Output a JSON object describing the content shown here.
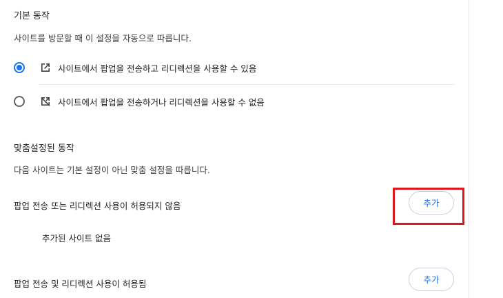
{
  "default_behavior": {
    "title": "기본 동작",
    "description": "사이트를 방문할 때 이 설정을 자동으로 따릅니다.",
    "options": [
      {
        "label": "사이트에서 팝업을 전송하고 리디렉션을 사용할 수 있음",
        "selected": true,
        "icon": "open-in-new-icon"
      },
      {
        "label": "사이트에서 팝업을 전송하거나 리디렉션을 사용할 수 없음",
        "selected": false,
        "icon": "open-in-new-off-icon"
      }
    ]
  },
  "custom_behavior": {
    "title": "맞춤설정된 동작",
    "description": "다음 사이트는 기본 설정이 아닌 맞춤 설정을 따릅니다.",
    "blocked": {
      "label": "팝업 전송 또는 리디렉션 사용이 허용되지 않음",
      "add_label": "추가",
      "empty_text": "추가된 사이트 없음"
    },
    "allowed": {
      "label": "팝업 전송 및 리디렉션 사용이 허용됨",
      "add_label": "추가"
    }
  },
  "colors": {
    "accent": "#1a73e8",
    "highlight": "#e0141c"
  }
}
